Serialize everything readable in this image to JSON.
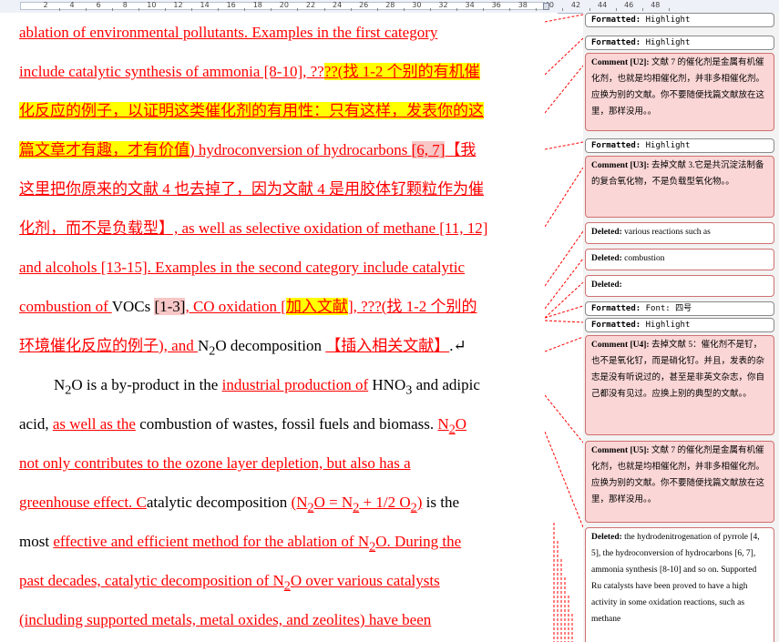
{
  "ruler": {
    "labels": [
      "2",
      "4",
      "6",
      "8",
      "10",
      "12",
      "14",
      "16",
      "18",
      "20",
      "22",
      "24",
      "26",
      "28",
      "30",
      "32",
      "34",
      "36",
      "38",
      "40",
      "42",
      "44",
      "46",
      "48"
    ]
  },
  "doc": {
    "l1": {
      "a": "ablation of environmental pollutants. Examples in the first category"
    },
    "l2": {
      "a": "include catalytic synthesis of ammonia [8-10], ??",
      "b": "??(找 1-2 个别的有机催"
    },
    "l3": {
      "a": "化反应的例子，以证明这类催化剂的有用性：只有这样，发表你的这"
    },
    "l4": {
      "a": "篇文章才有趣，才有价值",
      "b": ") hydroconversion of hydrocarbons ",
      "c": "[6, 7]",
      "d": "【我"
    },
    "l5": {
      "a": "这里把你原来的文献 4 也去掉了，因为文献 4 是用胶体钌颗粒作为催"
    },
    "l6": {
      "a": "化剂，而不是负载型】, as well as selective oxidation of methane [11, 12]"
    },
    "l7": {
      "a": "and alcohols [13-15]. Examples in the second category include catalytic"
    },
    "l8": {
      "a": "combustion of ",
      "b": "VOCs ",
      "c": "[1-3]",
      "d": ", CO oxidation [",
      "e": "加入文献",
      "f": "], ???(找 1-2 个别的"
    },
    "l9": {
      "a": "环境催化反应的例子), and ",
      "b": "N",
      "c": "2",
      "d": "O decomposition ",
      "e": "【插入相关文献】",
      "f": ".↵"
    },
    "l10": {
      "a": "N",
      "b": "2",
      "c": "O is a by-product in the ",
      "d": "industrial production of",
      "e": " HNO",
      "f": "3",
      "g": " and adipic"
    },
    "l11": {
      "a": "acid, ",
      "b": "as well as the",
      "c": " combustion of wastes, fossil fuels and biomass. ",
      "d": "N",
      "e": "2",
      "f": "O"
    },
    "l12": {
      "a": "not only contributes to the ozone layer depletion, but also has a"
    },
    "l13": {
      "a": "greenhouse effect. C",
      "b": "atalytic decomposition ",
      "c": "(N",
      "d": "2",
      "e": "O = N",
      "f": "2",
      "g": " + 1/2 O",
      "h": "2",
      "i": ")",
      "j": " is the"
    },
    "l14": {
      "a": "most ",
      "b": "effective and efficient method for the ablation of N",
      "c": "2",
      "d": "O. During the"
    },
    "l15": {
      "a": "past decades, catalytic decomposition of N",
      "b": "2",
      "c": "O over various catalysts"
    },
    "l16": {
      "a": "(including supported metals, metal oxides, and zeolites) have been"
    }
  },
  "markup": [
    {
      "type": "Formatted:",
      "text": "Highlight"
    },
    {
      "type": "Formatted:",
      "text": "Highlight"
    },
    {
      "type": "Comment [U2]:",
      "text": "文献 7 的催化剂是金属有机催化剂，也就是均相催化剂，并非多相催化剂。应换为别的文献。你不要随便找篇文献放在这里，那样没用。。"
    },
    {
      "type": "Formatted:",
      "text": "Highlight"
    },
    {
      "type": "Comment [U3]:",
      "text": "去掉文献 3.它是共沉淀法制备的复合氧化物，不是负载型氧化物。。"
    },
    {
      "type": "Deleted:",
      "text": "various reactions such as"
    },
    {
      "type": "Deleted:",
      "text": "combustion"
    },
    {
      "type": "Deleted:",
      "text": ""
    },
    {
      "type": "Formatted:",
      "text": "Font: 四号"
    },
    {
      "type": "Formatted:",
      "text": "Highlight"
    },
    {
      "type": "Comment [U4]:",
      "text": "去掉文献 5：催化剂不是钌，也不是氧化钌，而是硝化钌。并且，发表的杂志是没有听说过的，甚至是非英文杂志，你自己都没有见过。应换上别的典型的文献。。"
    },
    {
      "type": "Comment [U5]:",
      "text": "文献 7 的催化剂是金属有机催化剂，也就是均相催化剂，并非多相催化剂。应换为别的文献。你不要随便找篇文献放在这里，那样没用。。"
    },
    {
      "type": "Deleted:",
      "text": "the hydrodenitrogenation of pyrrole [4, 5], the hydroconversion of hydrocarbons [6, 7], ammonia synthesis [8-10] and so on. Supported Ru catalysts have been proved to have a high activity in some oxidation reactions, such as methane"
    }
  ]
}
